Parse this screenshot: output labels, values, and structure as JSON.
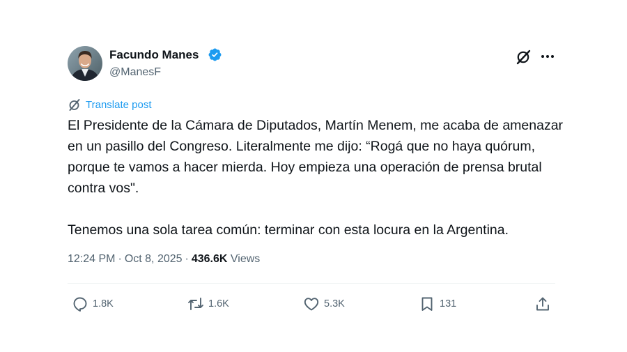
{
  "author": {
    "display_name": "Facundo Manes",
    "handle": "@ManesF",
    "verified_color": "#1d9bf0"
  },
  "header_icons": [
    "grok-icon",
    "more-icon"
  ],
  "translate": {
    "label": "Translate post",
    "icon": "translate-icon",
    "color": "#1d9bf0"
  },
  "tweet": {
    "paragraphs": [
      "El Presidente de la Cámara de Diputados, Martín Menem, me acaba de amenazar en un pasillo del Congreso. Literalmente me dijo: “Rogá que no haya quórum, porque te vamos a hacer mierda. Hoy empieza una operación de prensa brutal contra vos\".",
      "Tenemos una sola tarea común: terminar con esta locura en la Argentina."
    ]
  },
  "meta": {
    "time": "12:24 PM",
    "separator": "·",
    "date": "Oct 8, 2025",
    "views_count": "436.6K",
    "views_label": "Views"
  },
  "actions": {
    "replies": "1.8K",
    "reposts": "1.6K",
    "likes": "5.3K",
    "bookmarks": "131"
  },
  "colors": {
    "text": "#0f1419",
    "secondary": "#536471",
    "divider": "#eff3f4"
  }
}
